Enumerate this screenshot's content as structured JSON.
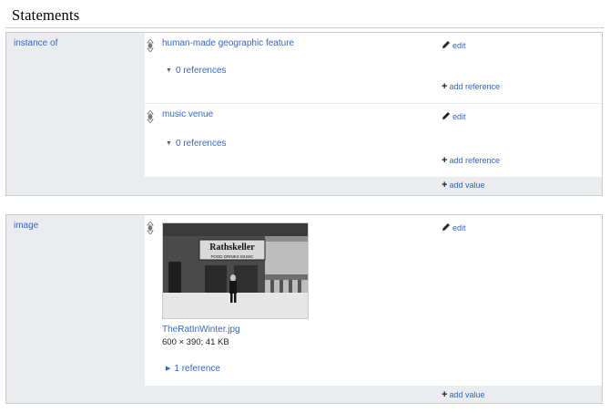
{
  "section": {
    "title": "Statements"
  },
  "groups": [
    {
      "property": "instance of",
      "statements": [
        {
          "value": "human-made geographic feature",
          "edit": "edit",
          "references": "0 references",
          "add_reference": "add reference"
        },
        {
          "value": "music venue",
          "edit": "edit",
          "references": "0 references",
          "add_reference": "add reference"
        }
      ],
      "add_value": "add value"
    },
    {
      "property": "image",
      "statements": [
        {
          "image": {
            "filename": "TheRatInWinter.jpg",
            "meta": "600 × 390; 41 KB",
            "sign_text": "Rathskeller",
            "sign_subtext": "FOOD  DRINKS  MUSIC"
          },
          "edit": "edit",
          "references": "1 reference"
        }
      ],
      "add_value": "add value"
    }
  ],
  "icons": {
    "edit": "pencil-icon",
    "add": "plus-icon",
    "rank": "normal-rank-icon",
    "expand": "triangle-icon"
  },
  "colors": {
    "link": "#3366cc",
    "group_bg": "#eaecf0",
    "border": "#c8ccd1"
  }
}
